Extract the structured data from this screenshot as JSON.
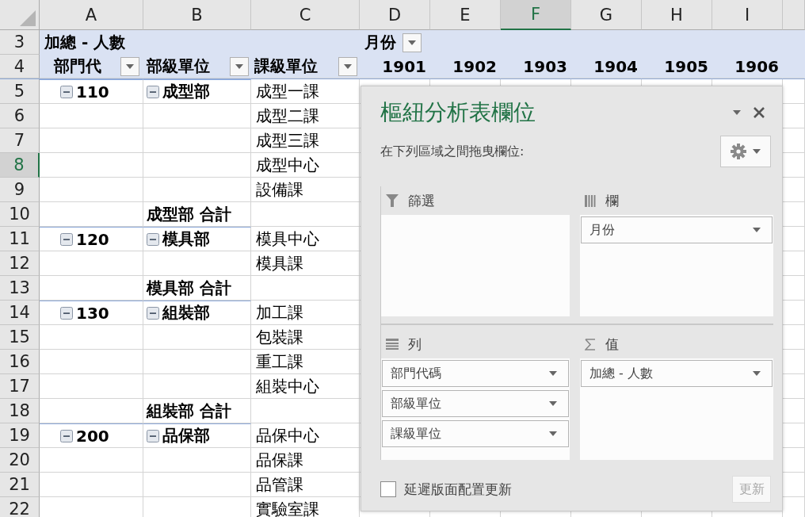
{
  "column_headers": [
    {
      "label": "A",
      "selected": false
    },
    {
      "label": "B",
      "selected": false
    },
    {
      "label": "C",
      "selected": false
    },
    {
      "label": "D",
      "selected": false
    },
    {
      "label": "E",
      "selected": false
    },
    {
      "label": "F",
      "selected": true
    },
    {
      "label": "G",
      "selected": false
    },
    {
      "label": "H",
      "selected": false
    },
    {
      "label": "I",
      "selected": false
    }
  ],
  "pivot": {
    "value_label": "加總 - 人數",
    "column_field": "月份",
    "row_fields": [
      "部門代",
      "部級單位",
      "課級單位"
    ],
    "months": [
      "1901",
      "1902",
      "1903",
      "1904",
      "1905",
      "1906"
    ]
  },
  "rows": [
    {
      "number": "3",
      "selected": false,
      "kind": "title"
    },
    {
      "number": "4",
      "selected": false,
      "kind": "header"
    },
    {
      "number": "5",
      "selected": false,
      "kind": "group",
      "code": "110",
      "dept": "成型部",
      "section": "成型一課"
    },
    {
      "number": "6",
      "selected": false,
      "kind": "item",
      "section": "成型二課"
    },
    {
      "number": "7",
      "selected": false,
      "kind": "item",
      "section": "成型三課"
    },
    {
      "number": "8",
      "selected": true,
      "kind": "item",
      "section": "成型中心"
    },
    {
      "number": "9",
      "selected": false,
      "kind": "item",
      "section": "設備課"
    },
    {
      "number": "10",
      "selected": false,
      "kind": "subtotal",
      "total": "成型部 合計"
    },
    {
      "number": "11",
      "selected": false,
      "kind": "group",
      "code": "120",
      "dept": "模具部",
      "section": "模具中心"
    },
    {
      "number": "12",
      "selected": false,
      "kind": "item",
      "section": "模具課"
    },
    {
      "number": "13",
      "selected": false,
      "kind": "subtotal",
      "total": "模具部 合計"
    },
    {
      "number": "14",
      "selected": false,
      "kind": "group",
      "code": "130",
      "dept": "組裝部",
      "section": "加工課"
    },
    {
      "number": "15",
      "selected": false,
      "kind": "item",
      "section": "包裝課"
    },
    {
      "number": "16",
      "selected": false,
      "kind": "item",
      "section": "重工課"
    },
    {
      "number": "17",
      "selected": false,
      "kind": "item",
      "section": "組裝中心"
    },
    {
      "number": "18",
      "selected": false,
      "kind": "subtotal",
      "total": "組裝部 合計"
    },
    {
      "number": "19",
      "selected": false,
      "kind": "group",
      "code": "200",
      "dept": "品保部",
      "section": "品保中心"
    },
    {
      "number": "20",
      "selected": false,
      "kind": "item",
      "section": "品保課"
    },
    {
      "number": "21",
      "selected": false,
      "kind": "item",
      "section": "品管課"
    },
    {
      "number": "22",
      "selected": false,
      "kind": "item",
      "section": "實驗室課"
    }
  ],
  "field_pane": {
    "title": "樞紐分析表欄位",
    "instruction": "在下列區域之間拖曳欄位:",
    "areas": [
      {
        "kind": "filter",
        "label": "篩選"
      },
      {
        "kind": "columns",
        "label": "欄",
        "fields": [
          "月份"
        ]
      },
      {
        "kind": "rows",
        "label": "列",
        "fields": [
          "部門代碼",
          "部級單位",
          "課級單位"
        ]
      },
      {
        "kind": "values",
        "label": "值",
        "fields": [
          "加總 - 人數"
        ]
      }
    ],
    "defer_update": {
      "label": "延遲版面配置更新",
      "checked": false
    },
    "update_button": {
      "label": "更新",
      "disabled": true
    }
  }
}
